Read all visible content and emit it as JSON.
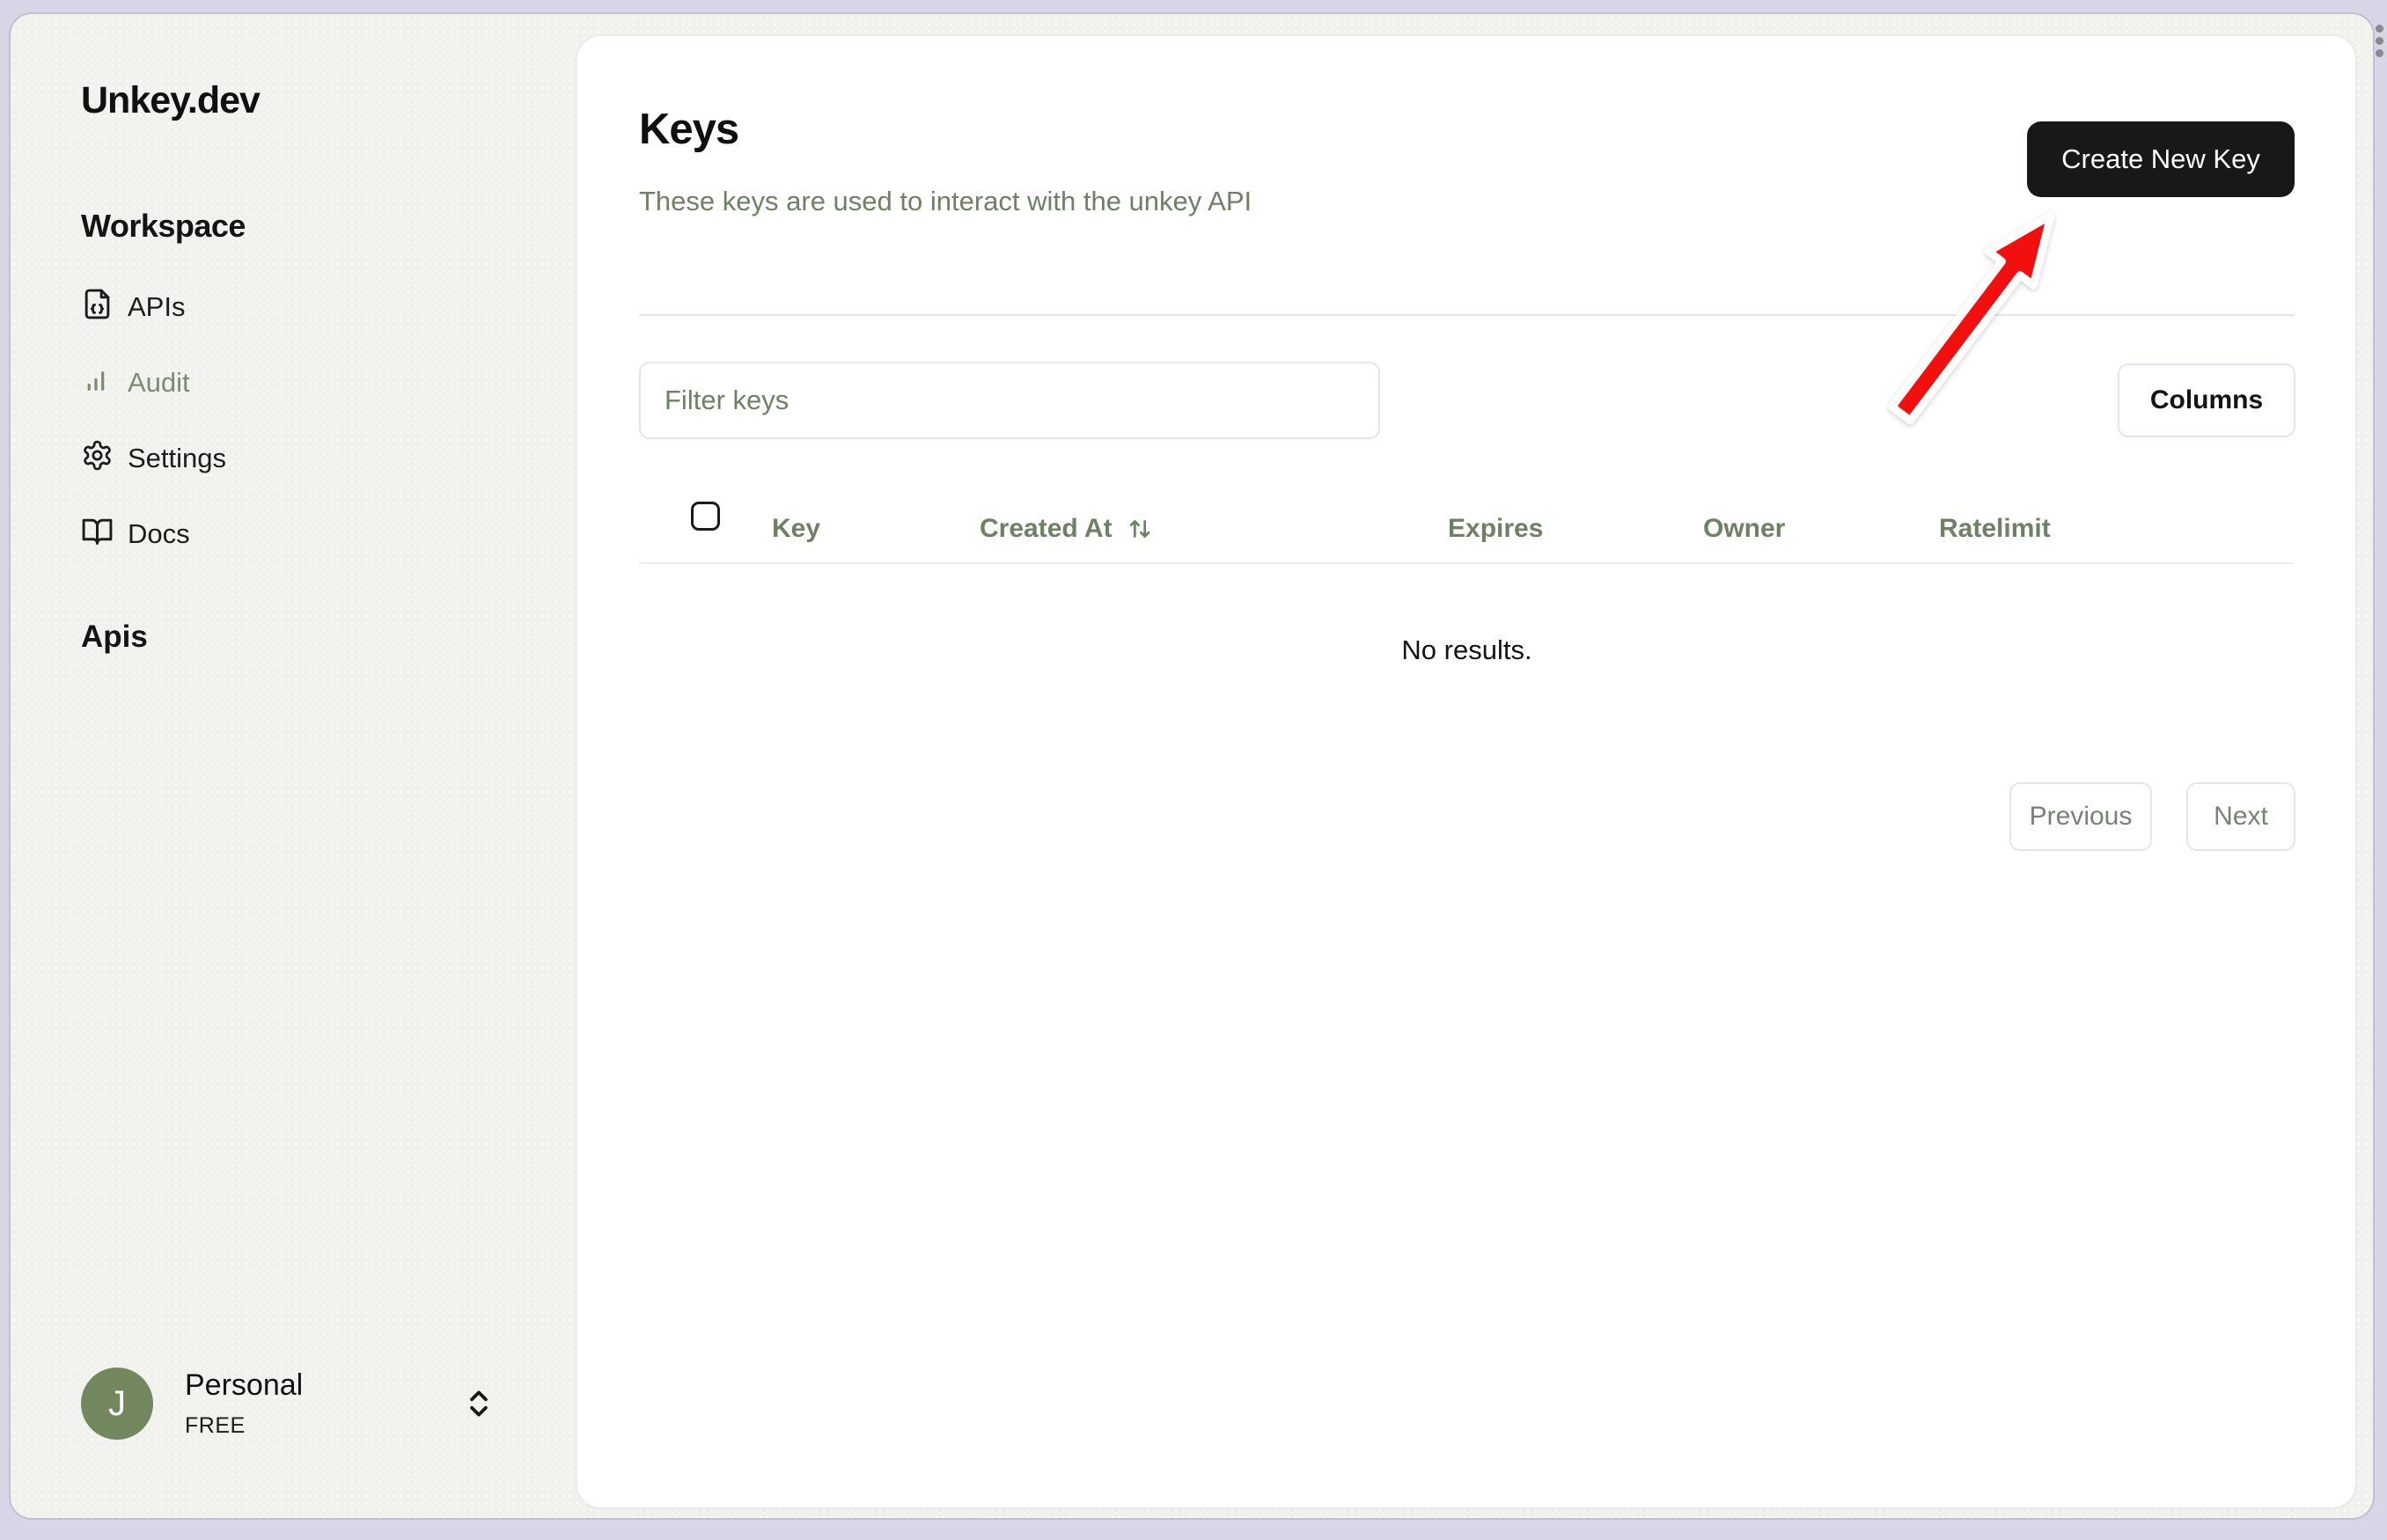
{
  "app": {
    "logo": "Unkey.dev"
  },
  "sidebar": {
    "workspace_heading": "Workspace",
    "nav": [
      {
        "label": "APIs",
        "icon": "file-code-icon"
      },
      {
        "label": "Audit",
        "icon": "bar-chart-icon",
        "muted": true
      },
      {
        "label": "Settings",
        "icon": "gear-icon"
      },
      {
        "label": "Docs",
        "icon": "book-open-icon"
      }
    ],
    "apis_heading": "Apis",
    "account": {
      "avatar_initial": "J",
      "name": "Personal",
      "plan": "FREE",
      "icon": "chevrons-up-down-icon"
    }
  },
  "main": {
    "title": "Keys",
    "subtitle": "These keys are used to interact with the unkey API",
    "create_key_button": "Create New Key",
    "filter_placeholder": "Filter keys",
    "columns_button": "Columns",
    "table": {
      "columns": [
        "Key",
        "Created At",
        "Expires",
        "Owner",
        "Ratelimit"
      ],
      "sorted_column": "Created At",
      "sort_icon": "arrows-up-down-icon",
      "empty_message": "No results."
    },
    "pagination": {
      "previous_label": "Previous",
      "next_label": "Next"
    }
  },
  "annotations": {
    "arrow": {
      "shape": "red-arrow-with-white-outline",
      "points_to": "Create New Key button",
      "color": "#f40f0f"
    }
  },
  "colors": {
    "outer_background": "#d8d5e7",
    "app_background": "#f1f1ee",
    "card_background": "#ffffff",
    "accent_green_text": "#6e8163",
    "muted_nav_green": "#7e8b72",
    "avatar_green": "#74885f",
    "dark_button": "#18181b",
    "arrow_red": "#f40f0f"
  }
}
